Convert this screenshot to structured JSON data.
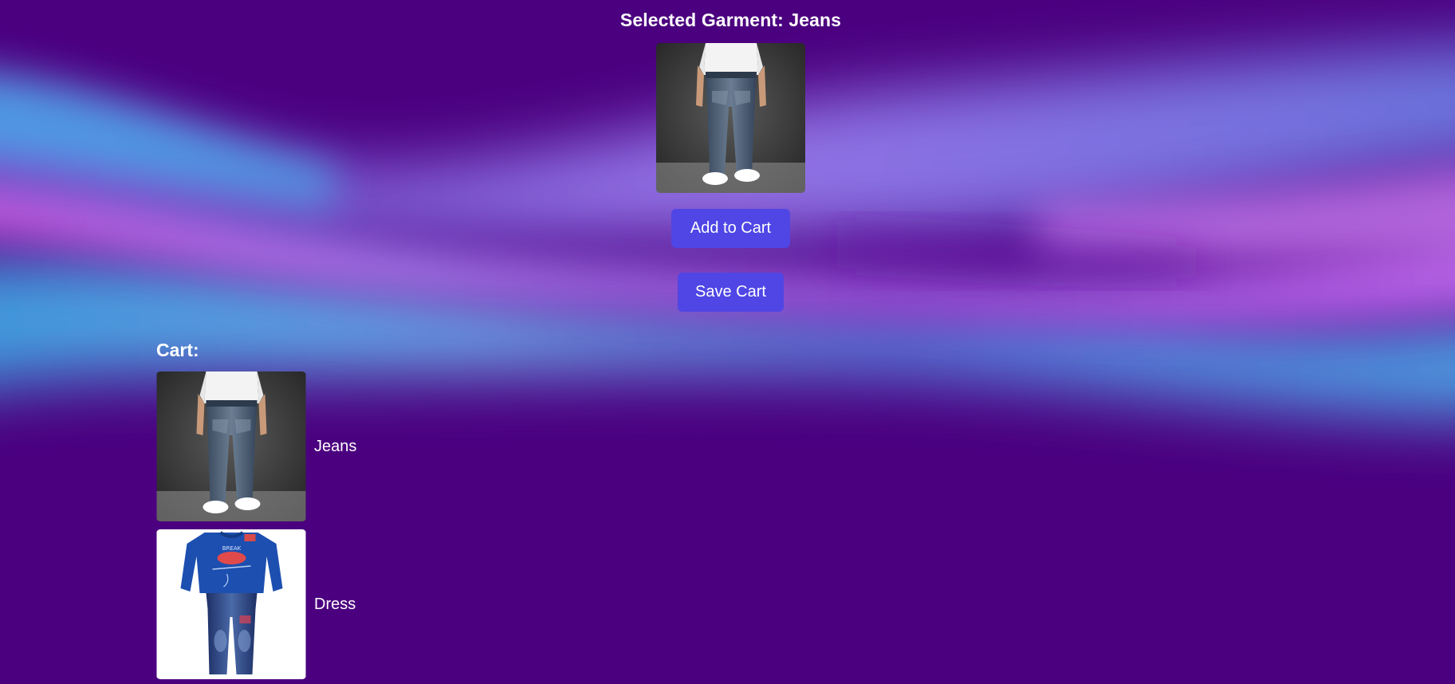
{
  "selected": {
    "heading": "Selected Garment: Jeans",
    "image_icon": "jeans-photo"
  },
  "actions": {
    "add_to_cart_label": "Add to Cart",
    "save_cart_label": "Save Cart"
  },
  "cart": {
    "heading": "Cart:",
    "items": [
      {
        "label": "Jeans",
        "image_icon": "jeans-photo"
      },
      {
        "label": "Dress",
        "image_icon": "kids-outfit-photo"
      }
    ]
  },
  "colors": {
    "background": "#4b007f",
    "button": "#4f46e5",
    "text": "#ffffff"
  }
}
